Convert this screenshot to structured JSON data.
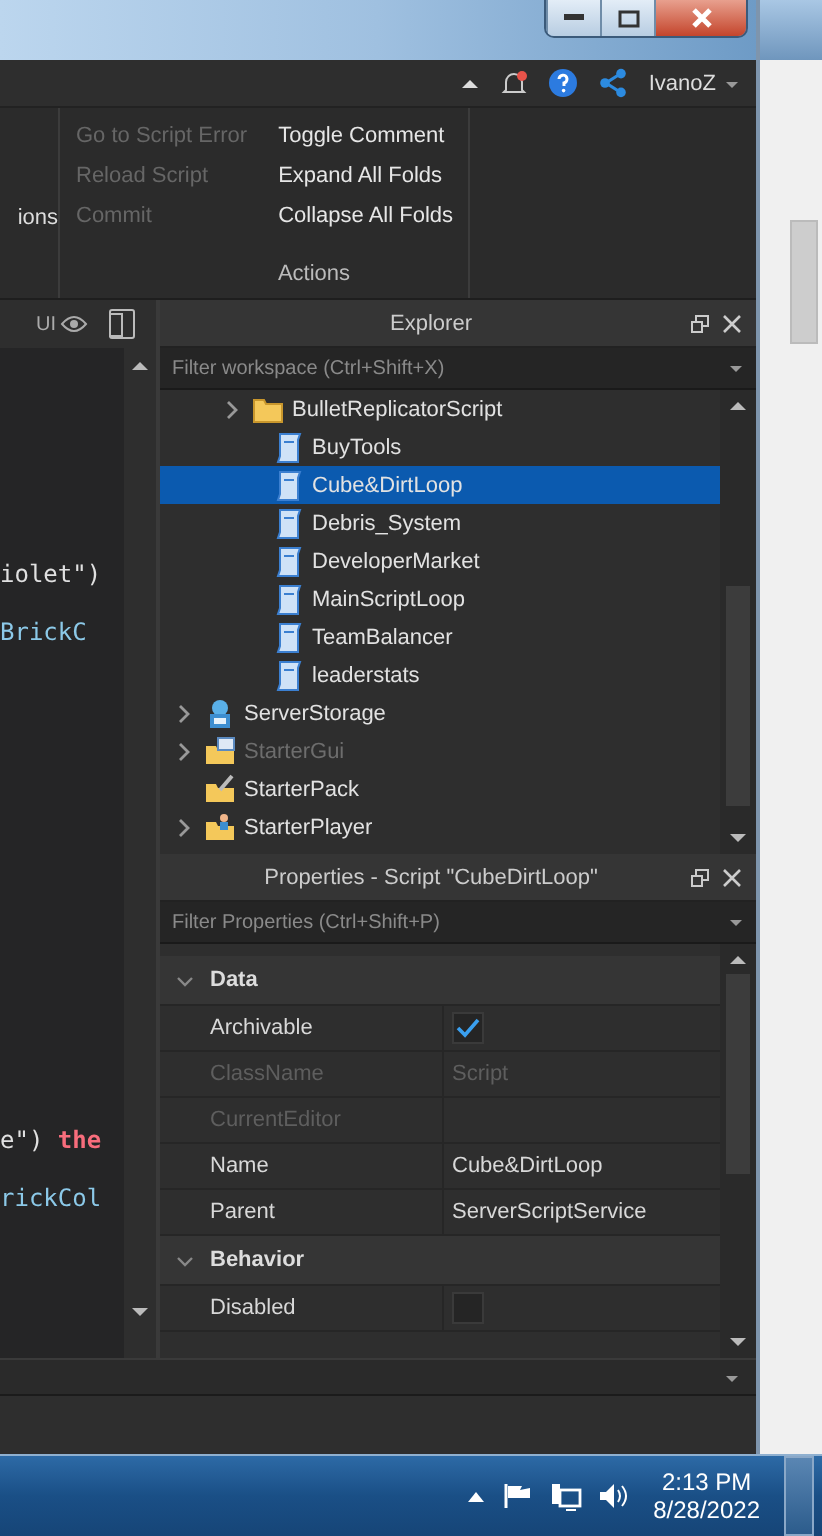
{
  "account": {
    "user": "IvanoZ"
  },
  "ribbon": {
    "partial_label": "ions",
    "group_label": "Actions",
    "columns": [
      [
        {
          "label": "Go to Script Error",
          "disabled": true
        },
        {
          "label": "Reload Script",
          "disabled": true
        },
        {
          "label": "Commit",
          "disabled": true
        }
      ],
      [
        {
          "label": "Toggle Comment",
          "disabled": false
        },
        {
          "label": "Expand All Folds",
          "disabled": false
        },
        {
          "label": "Collapse All Folds",
          "disabled": false
        }
      ]
    ]
  },
  "code": {
    "toolbar_label": "UI",
    "blocks": [
      [
        [
          {
            "text": "iolet\")",
            "kind": "plain"
          }
        ],
        [
          {
            "text": "BrickC",
            "kind": "property"
          }
        ]
      ],
      [
        [
          {
            "text": "e\") ",
            "kind": "plain"
          },
          {
            "text": "the",
            "kind": "keyword"
          }
        ],
        [
          {
            "text": "rickCol",
            "kind": "property"
          }
        ]
      ]
    ]
  },
  "explorer": {
    "title": "Explorer",
    "filter_placeholder": "Filter workspace (Ctrl+Shift+X)",
    "nested_items": [
      {
        "label": "BulletReplicatorScript",
        "kind": "folder",
        "expandable": true,
        "selected": false,
        "dimmed": false
      },
      {
        "label": "BuyTools",
        "kind": "script",
        "expandable": false,
        "selected": false,
        "dimmed": false
      },
      {
        "label": "Cube&DirtLoop",
        "kind": "script",
        "expandable": false,
        "selected": true,
        "dimmed": false
      },
      {
        "label": "Debris_System",
        "kind": "script",
        "expandable": false,
        "selected": false,
        "dimmed": false
      },
      {
        "label": "DeveloperMarket",
        "kind": "script",
        "expandable": false,
        "selected": false,
        "dimmed": false
      },
      {
        "label": "MainScriptLoop",
        "kind": "script",
        "expandable": false,
        "selected": false,
        "dimmed": false
      },
      {
        "label": "TeamBalancer",
        "kind": "script",
        "expandable": false,
        "selected": false,
        "dimmed": false
      },
      {
        "label": "leaderstats",
        "kind": "script",
        "expandable": false,
        "selected": false,
        "dimmed": false
      }
    ],
    "items": [
      {
        "label": "ServerStorage",
        "kind": "storage",
        "expandable": true,
        "selected": false,
        "dimmed": false
      },
      {
        "label": "StarterGui",
        "kind": "gui",
        "expandable": true,
        "selected": false,
        "dimmed": true
      },
      {
        "label": "StarterPack",
        "kind": "pack",
        "expandable": false,
        "selected": false,
        "dimmed": false
      },
      {
        "label": "StarterPlayer",
        "kind": "player",
        "expandable": true,
        "selected": false,
        "dimmed": false
      }
    ]
  },
  "properties": {
    "title": "Properties - Script \"CubeDirtLoop\"",
    "filter_placeholder": "Filter Properties (Ctrl+Shift+P)",
    "sections": [
      {
        "name": "Data",
        "expanded": true,
        "rows": [
          {
            "name": "Archivable",
            "kind": "checkbox",
            "checked": true,
            "disabled": false
          },
          {
            "name": "ClassName",
            "kind": "text",
            "value": "Script",
            "disabled": true
          },
          {
            "name": "CurrentEditor",
            "kind": "text",
            "disabled": true
          },
          {
            "name": "Name",
            "kind": "text",
            "value": "Cube&DirtLoop",
            "disabled": false
          },
          {
            "name": "Parent",
            "kind": "text",
            "value": "ServerScriptService",
            "disabled": false
          }
        ]
      },
      {
        "name": "Behavior",
        "expanded": true,
        "rows": [
          {
            "name": "Disabled",
            "kind": "checkbox",
            "checked": false,
            "disabled": false
          }
        ]
      }
    ]
  },
  "taskbar": {
    "time": "2:13 PM",
    "date": "8/28/2022"
  }
}
